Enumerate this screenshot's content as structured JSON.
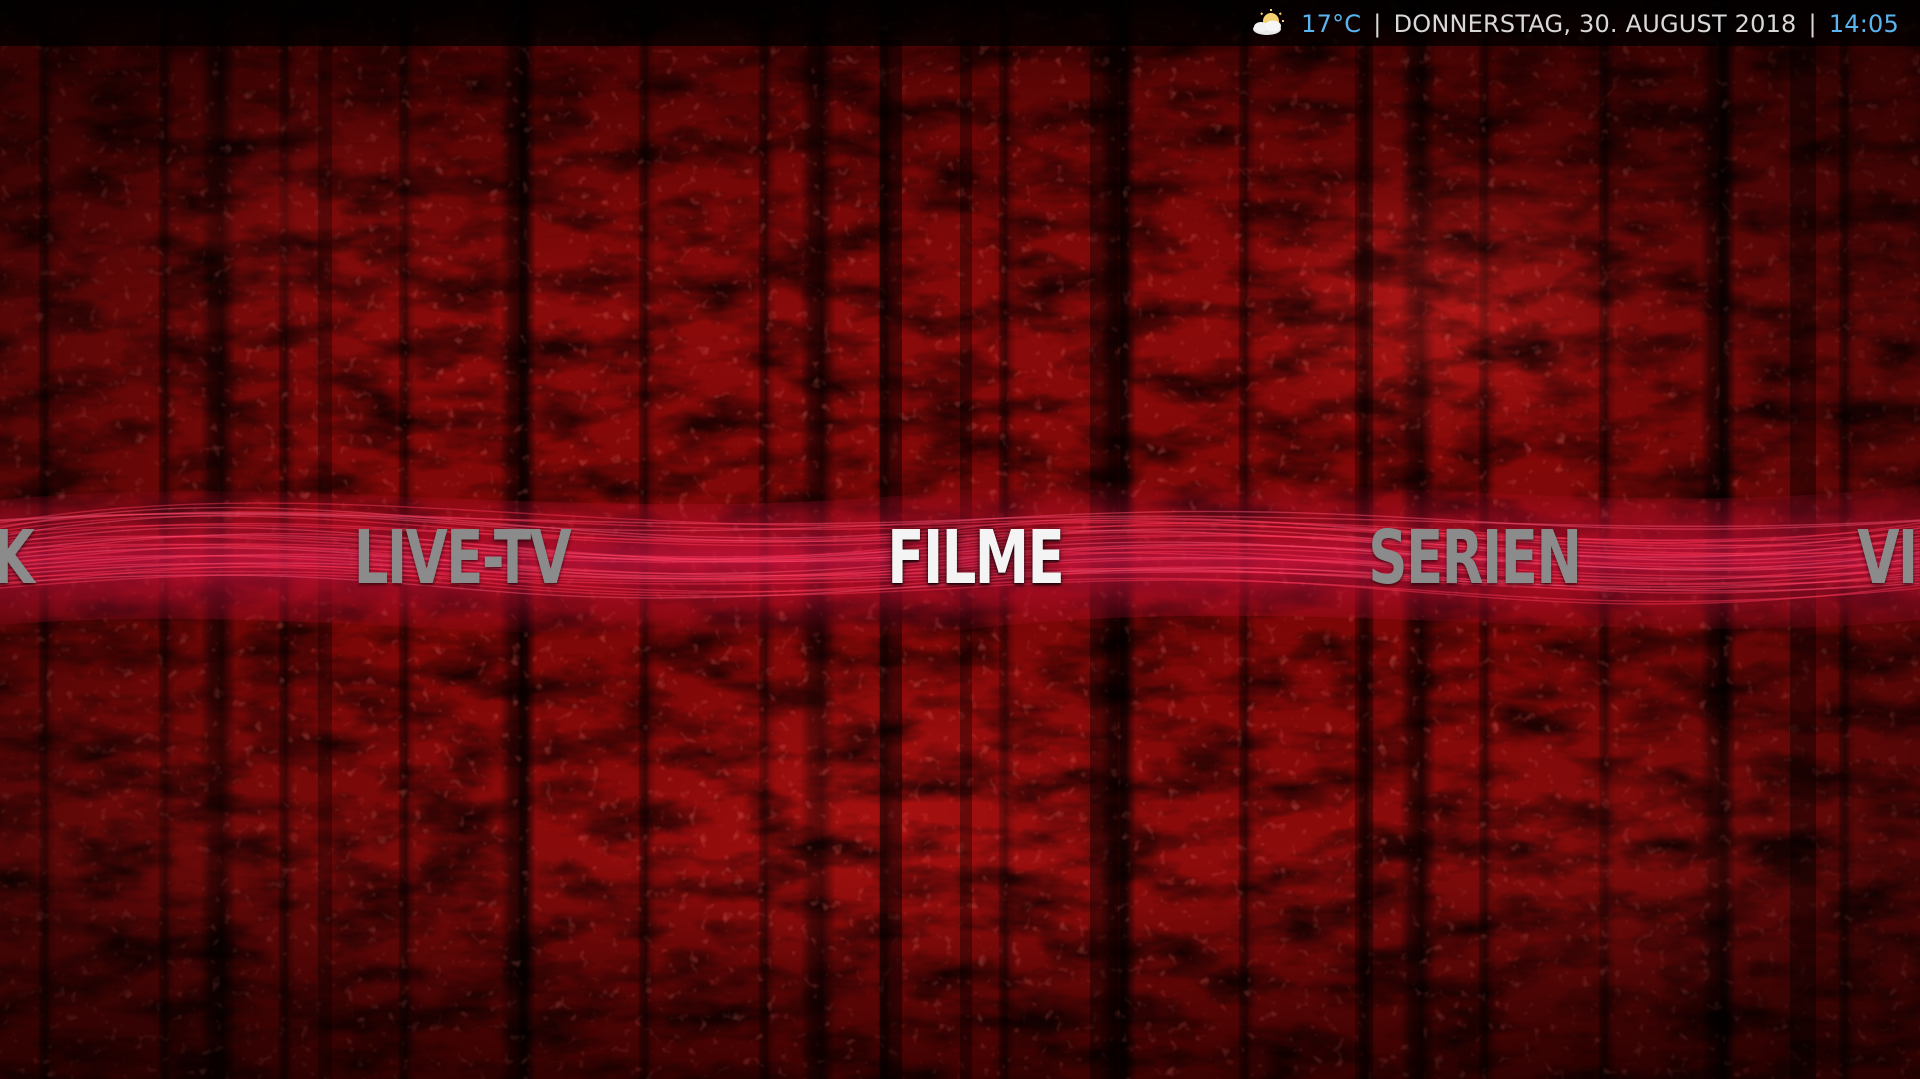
{
  "statusbar": {
    "weather_icon": "partly-sunny-icon",
    "temperature": "17°C",
    "separator": "|",
    "date": "DONNERSTAG, 30. AUGUST 2018",
    "time": "14:05",
    "accent_color": "#5ab4f0",
    "text_color": "#d8d8d8"
  },
  "home_menu": {
    "items": [
      {
        "label": "K",
        "state": "partial"
      },
      {
        "label": "LIVE-TV",
        "state": "normal"
      },
      {
        "label": "FILME",
        "state": "selected"
      },
      {
        "label": "SERIEN",
        "state": "normal"
      },
      {
        "label": "VID",
        "state": "partial"
      }
    ],
    "selected_color": "#f4f4f4",
    "unselected_color": "#8b8b8b",
    "ribbon_color": "#e0153c"
  },
  "background": {
    "theme": "red-grunge-texture",
    "base_color": "#8a0a0a"
  }
}
